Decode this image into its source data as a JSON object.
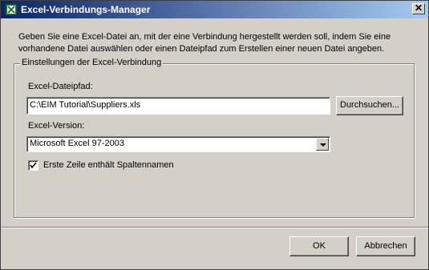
{
  "window": {
    "title": "Excel-Verbindungs-Manager",
    "close_symbol": "✕"
  },
  "description": "Geben Sie eine Excel-Datei an, mit der eine Verbindung hergestellt werden soll, indem Sie eine vorhandene Datei auswählen oder einen Dateipfad zum Erstellen einer neuen Datei angeben.",
  "group": {
    "legend": "Einstellungen der Excel-Verbindung",
    "path_label": "Excel-Dateipfad:",
    "path_value": "C:\\EIM Tutorial\\Suppliers.xls",
    "browse_label": "Durchsuchen...",
    "version_label": "Excel-Version:",
    "version_value": "Microsoft Excel 97-2003",
    "checkbox_label": "Erste Zeile enthält Spaltennamen",
    "checkbox_checked": true
  },
  "buttons": {
    "ok": "OK",
    "cancel": "Abbrechen"
  },
  "colors": {
    "titlebar_start": "#0a246a",
    "titlebar_end": "#a6caf0",
    "face": "#d4d0c8"
  }
}
